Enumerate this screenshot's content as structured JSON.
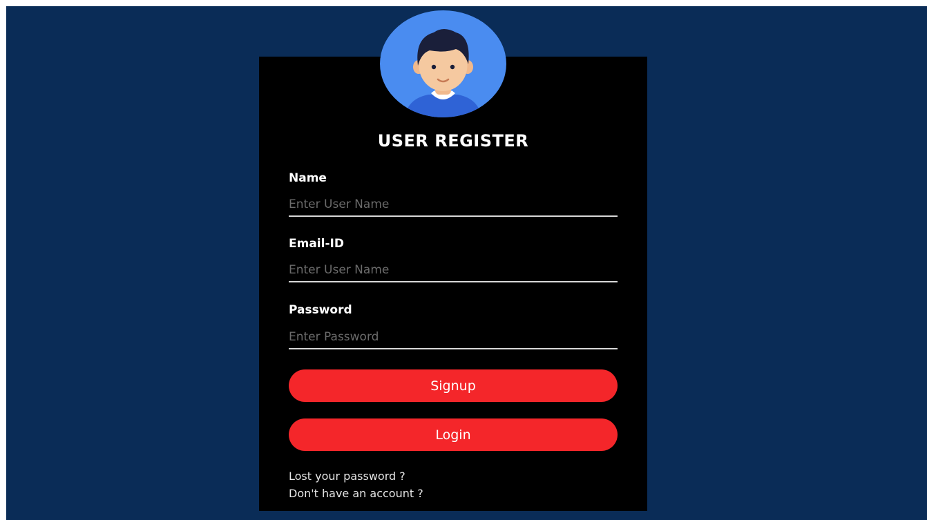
{
  "form": {
    "title": "USER REGISTER",
    "fields": [
      {
        "label": "Name",
        "placeholder": "Enter User Name",
        "value": ""
      },
      {
        "label": "Email-ID",
        "placeholder": "Enter User Name",
        "value": ""
      },
      {
        "label": "Password",
        "placeholder": "Enter Password",
        "value": ""
      }
    ],
    "signup_label": "Signup",
    "login_label": "Login",
    "lost_password_link": "Lost your password ?",
    "no_account_link": "Don't have an account ?"
  },
  "avatar": {
    "icon": "user-avatar-icon"
  },
  "colors": {
    "background": "#0a2c57",
    "card": "#000000",
    "accent": "#f4262a",
    "avatar_circle": "#4a8cf0"
  }
}
